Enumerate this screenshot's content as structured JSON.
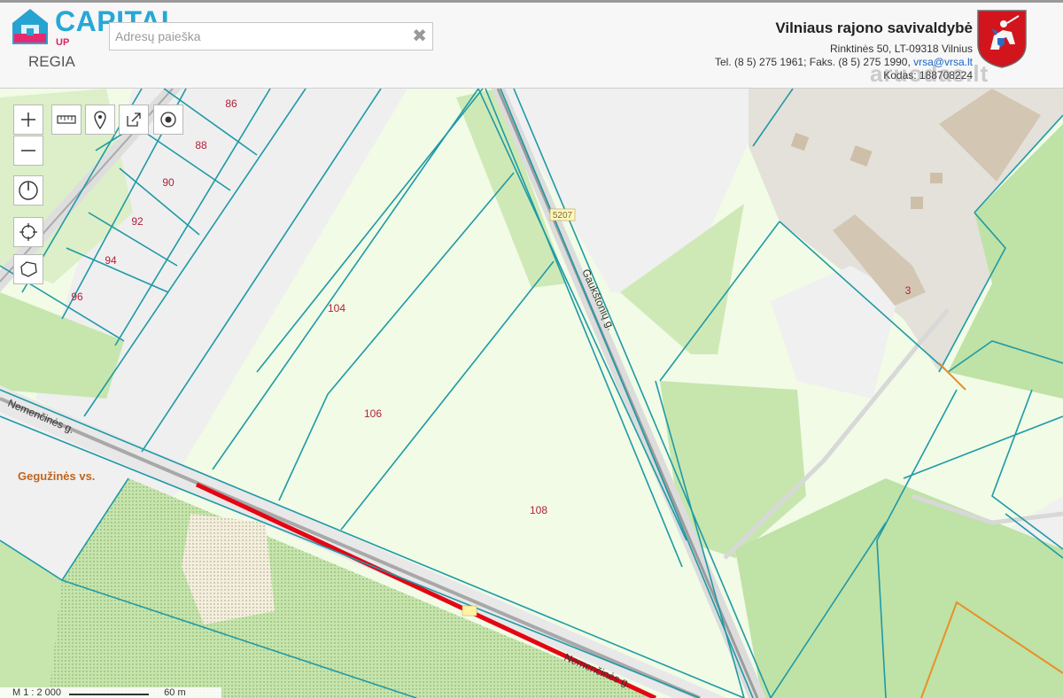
{
  "brand": {
    "name": "CAPITAL",
    "sub": "UP",
    "tagline": "REGIA"
  },
  "search": {
    "placeholder": "Adresų paieška",
    "value": ""
  },
  "municipality": {
    "name": "Vilniaus rajono savivaldybė",
    "address": "Rinktinės 50, LT-09318 Vilnius",
    "phone": "Tel. (8 5) 275 1961; Faks. (8 5) 275 1990, ",
    "email": "vrsa@vrsa.lt",
    "code": "Kodas: 188708224"
  },
  "watermark": "aruodas.lt",
  "map": {
    "parcels": [
      "86",
      "88",
      "90",
      "92",
      "94",
      "96",
      "104",
      "106",
      "108",
      "3"
    ],
    "streets": [
      "Nemenčinės g.",
      "Gaukštonių g.",
      "Gegužinės vs."
    ],
    "road_number": "5207",
    "colors": {
      "boundary": "#1e9aa6",
      "road_highlight": "#e60000",
      "area_label": "#c0651f",
      "parcel_label": "#b2213a",
      "green": "#bfe2a6",
      "light_green": "#f1fbe6"
    }
  },
  "scale": {
    "ratio": "M 1 : 2 000",
    "distance": "60 m"
  }
}
